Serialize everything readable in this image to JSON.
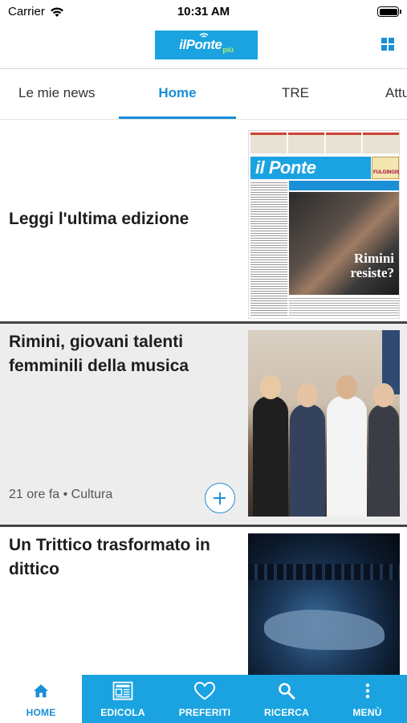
{
  "status_bar": {
    "carrier": "Carrier",
    "time": "10:31 AM"
  },
  "header": {
    "logo_text": "ilPonte",
    "logo_sub": "più"
  },
  "tabs": [
    {
      "label": "Le mie news",
      "active": false
    },
    {
      "label": "Home",
      "active": true
    },
    {
      "label": "TRE",
      "active": false
    },
    {
      "label": "Attu",
      "active": false
    }
  ],
  "articles": [
    {
      "title": "Leggi l'ultima edizione",
      "meta": "",
      "image": "newspaper-cover"
    },
    {
      "title": "Rimini, giovani talenti femminili della musica",
      "meta": "21 ore fa • Cultura",
      "image": "group-photo"
    },
    {
      "title": "Un Trittico trasformato in dittico",
      "meta": "",
      "image": "stage-photo"
    }
  ],
  "cover": {
    "masthead": "il Ponte",
    "ad": "FULGINGIS",
    "headline_line1": "Rimini",
    "headline_line2": "resiste?"
  },
  "tabbar": [
    {
      "label": "HOME",
      "icon": "home-icon",
      "active": true
    },
    {
      "label": "EDICOLA",
      "icon": "newspaper-icon",
      "active": false
    },
    {
      "label": "PREFERITI",
      "icon": "heart-icon",
      "active": false
    },
    {
      "label": "RICERCA",
      "icon": "search-icon",
      "active": false
    },
    {
      "label": "MENÙ",
      "icon": "more-vertical-icon",
      "active": false
    }
  ],
  "colors": {
    "accent": "#1a8fd6",
    "brand": "#1aa3e0",
    "card_alt_bg": "#ededed"
  }
}
